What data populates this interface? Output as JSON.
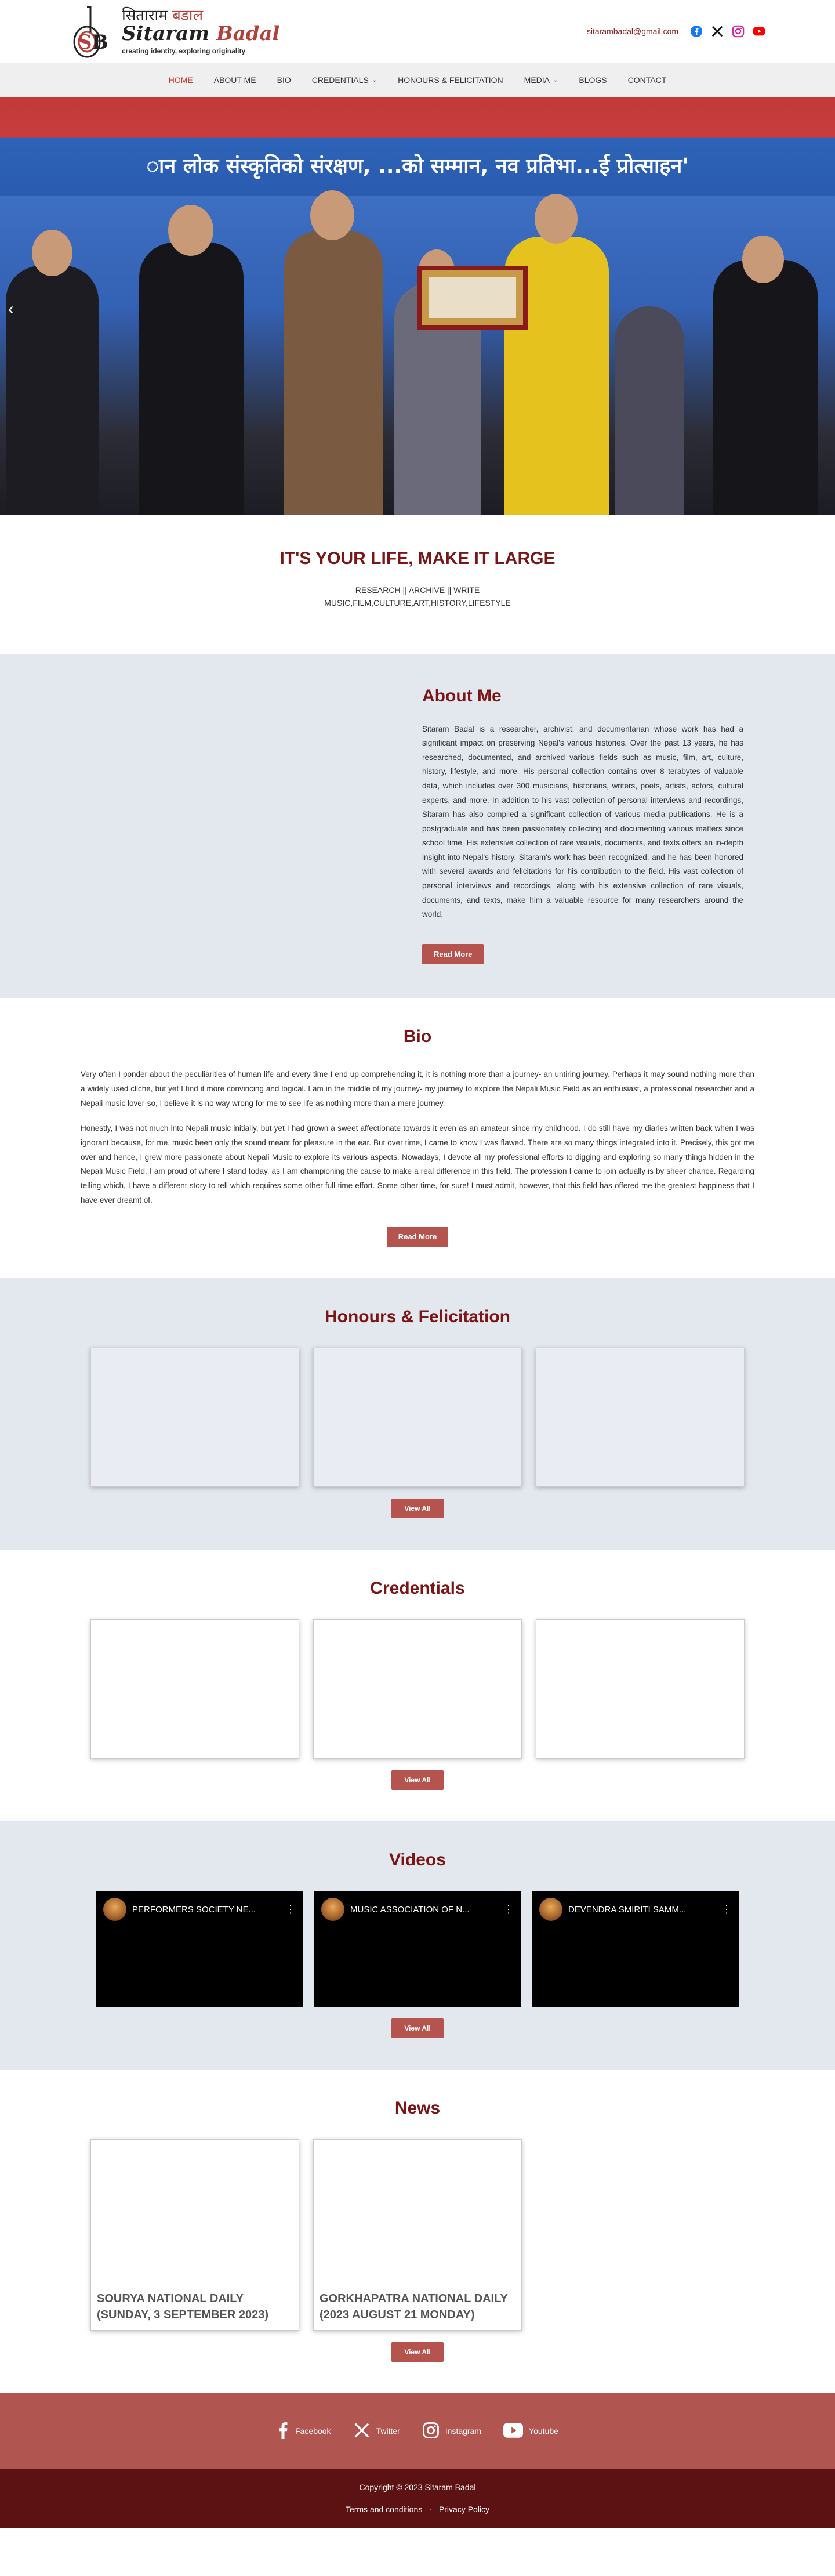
{
  "header": {
    "logo_np_black": "सिताराम ",
    "logo_np_red": "बडाल",
    "logo_en_black": "Sitaram ",
    "logo_en_red": "Badal",
    "logo_tag": "creating identity, exploring originality",
    "email": "sitarambadal@gmail.com",
    "social_icons": [
      "facebook-icon",
      "x-icon",
      "instagram-icon",
      "youtube-icon"
    ]
  },
  "nav": {
    "items": [
      {
        "label": "HOME",
        "active": true
      },
      {
        "label": "ABOUT ME"
      },
      {
        "label": "BIO"
      },
      {
        "label": "CREDENTIALS",
        "dropdown": true
      },
      {
        "label": "HONOURS & FELICITATION"
      },
      {
        "label": "MEDIA",
        "dropdown": true
      },
      {
        "label": "BLOGS"
      },
      {
        "label": "CONTACT"
      }
    ]
  },
  "hero": {
    "banner_text": "ान लोक संस्कृतिको संरक्षण, ...को सम्मान, नव प्रतिभा...ई प्रोत्साहन'",
    "prev_icon": "chevron-left-icon"
  },
  "tagline": {
    "title": "IT'S YOUR LIFE, MAKE IT LARGE",
    "line1": "RESEARCH || ARCHIVE || WRITE",
    "line2": "MUSIC,FILM,CULTURE,ART,HISTORY,LIFESTYLE"
  },
  "about": {
    "title": "About Me",
    "text": "Sitaram Badal is a researcher, archivist, and documentarian whose work has had a significant impact on preserving Nepal's various histories. Over the past 13 years, he has researched, documented, and archived various fields such as music, film, art, culture, history, lifestyle, and more. His personal collection contains over 8 terabytes of valuable data, which includes over 300 musicians, historians, writers, poets, artists, actors, cultural experts, and more. In addition to his vast collection of personal interviews and recordings, Sitaram has also compiled a significant collection of various media publications. He is a postgraduate and has been passionately collecting and documenting various matters since school time. His extensive collection of rare visuals, documents, and texts offers an in-depth insight into Nepal's history. Sitaram's work has been recognized, and he has been honored with several awards and felicitations for his contribution to the field. His vast collection of personal interviews and recordings, along with his extensive collection of rare visuals, documents, and texts, make him a valuable resource for many researchers around the world.",
    "button": "Read More"
  },
  "bio": {
    "title": "Bio",
    "p1": "Very often I ponder about the peculiarities of human life and every time I end up comprehending it, it is nothing more than a journey- an untiring journey. Perhaps it may sound nothing more than a widely used cliche, but yet I find it more convincing and logical. I am in the middle of my journey- my journey to explore the Nepali Music Field as an enthusiast, a professional researcher and a Nepali music lover-so, I believe it is no way wrong for me to see life as nothing more than a mere journey.",
    "p2": "Honestly, I was not much into Nepali music initially, but yet I had grown a sweet affectionate towards it even as an amateur since my childhood. I do still have my diaries written back when I was ignorant because, for me, music been only the sound meant for pleasure in the ear. But over time, I came to know I was flawed. There are so many things integrated into it. Precisely, this got me over and hence, I grew more passionate about Nepali Music to explore its various aspects. Nowadays, I devote all my professional efforts to digging and exploring so many things hidden in the Nepali Music Field. I am proud of where I stand today, as I am championing the cause to make a real difference in this field. The profession I came to join actually is by sheer chance. Regarding telling which, I have a different story to tell which requires some other full-time effort. Some other time, for sure! I must admit, however, that this field has offered me the greatest happiness that I have ever dreamt of.",
    "button": "Read More"
  },
  "honours": {
    "title": "Honours & Felicitation",
    "button": "View All"
  },
  "credentials": {
    "title": "Credentials",
    "button": "View All"
  },
  "videos": {
    "title": "Videos",
    "items": [
      {
        "title": "PERFORMERS SOCIETY NE..."
      },
      {
        "title": "MUSIC ASSOCIATION OF N..."
      },
      {
        "title": "DEVENDRA SMIRITI SAMM..."
      }
    ],
    "button": "View All"
  },
  "news": {
    "title": "News",
    "items": [
      {
        "title": "SOURYA NATIONAL DAILY (SUNDAY, 3 SEPTEMBER 2023)"
      },
      {
        "title": "GORKHAPATRA NATIONAL DAILY (2023 AUGUST 21 MONDAY)"
      }
    ],
    "button": "View All"
  },
  "footer": {
    "social": [
      {
        "label": "Facebook",
        "icon": "facebook-icon"
      },
      {
        "label": "Twitter",
        "icon": "x-icon"
      },
      {
        "label": "Instagram",
        "icon": "instagram-icon"
      },
      {
        "label": "Youtube",
        "icon": "youtube-icon"
      }
    ],
    "copyright": "Copyright © 2023 Sitaram Badal",
    "terms": "Terms and conditions",
    "separator": "·",
    "privacy": "Privacy Policy"
  },
  "colors": {
    "brand_dark_red": "#7a1616",
    "button_red": "#b5544f",
    "section_gray": "#e3e8ef",
    "footer_top": "#b15550",
    "footer_bottom": "#5c1212"
  }
}
